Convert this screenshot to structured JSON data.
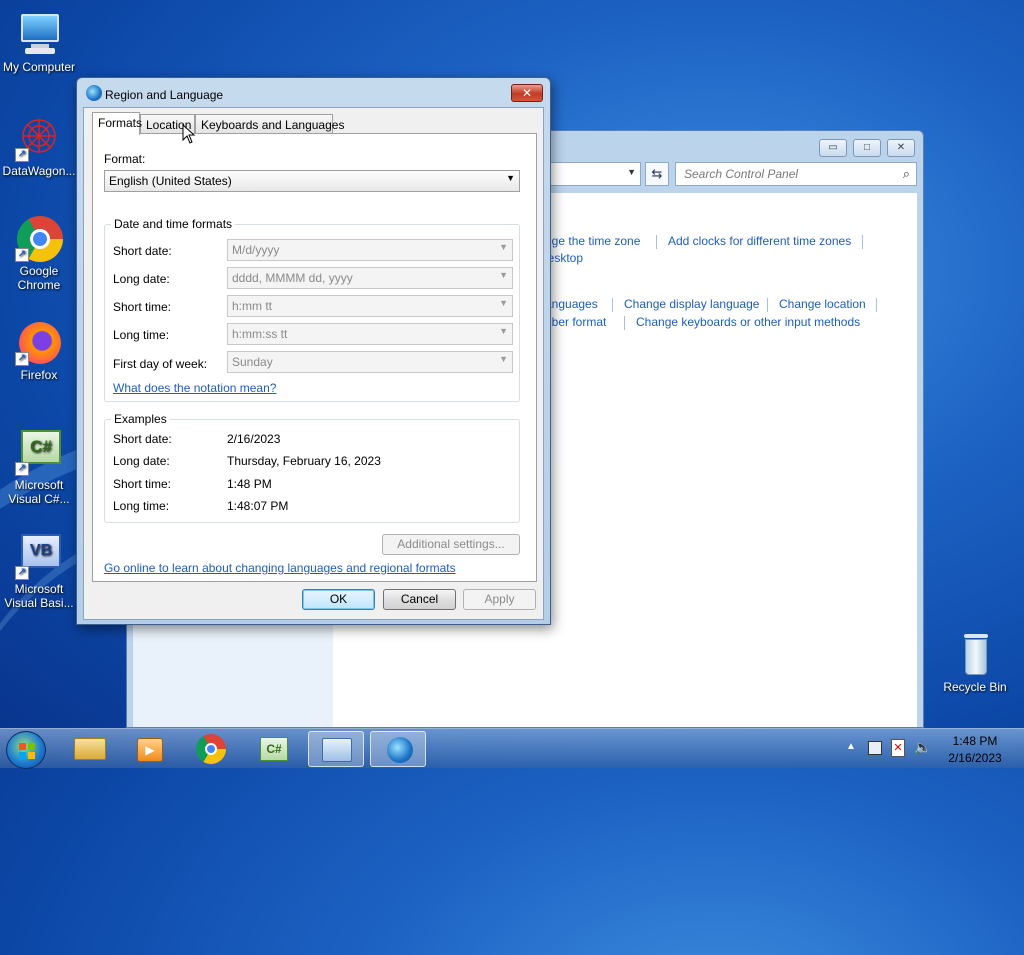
{
  "desktop": {
    "icons": [
      {
        "label": "My Computer",
        "icon": "my-computer-icon"
      },
      {
        "label": "DataWagon...",
        "icon": "datawagon-icon"
      },
      {
        "label": "Google Chrome",
        "icon": "chrome-icon"
      },
      {
        "label": "Firefox",
        "icon": "firefox-icon"
      },
      {
        "label": "Microsoft Visual C#...",
        "icon": "csharp-icon"
      },
      {
        "label": "Microsoft Visual Basi...",
        "icon": "vb-icon"
      },
      {
        "label": "Recycle Bin",
        "icon": "recycle-bin-icon"
      }
    ]
  },
  "control_panel": {
    "search_placeholder": "Search Control Panel",
    "links": [
      "nge the time zone",
      "Add clocks for different time zones",
      "lesktop",
      "anguages",
      "Change display language",
      "Change location",
      "nber format",
      "Change keyboards or other input methods"
    ]
  },
  "dialog": {
    "title": "Region and Language",
    "tabs": [
      "Formats",
      "Location",
      "Keyboards and Languages"
    ],
    "format_label": "Format:",
    "format_value": "English (United States)",
    "dt_group_title": "Date and time formats",
    "fields": [
      {
        "label": "Short date:",
        "value": "M/d/yyyy"
      },
      {
        "label": "Long date:",
        "value": "dddd, MMMM dd, yyyy"
      },
      {
        "label": "Short time:",
        "value": "h:mm tt"
      },
      {
        "label": "Long time:",
        "value": "h:mm:ss tt"
      },
      {
        "label": "First day of week:",
        "value": "Sunday"
      }
    ],
    "notation_link": "What does the notation mean?",
    "examples_title": "Examples",
    "examples": [
      {
        "label": "Short date:",
        "value": "2/16/2023"
      },
      {
        "label": "Long date:",
        "value": "Thursday, February 16, 2023"
      },
      {
        "label": "Short time:",
        "value": "1:48 PM"
      },
      {
        "label": "Long time:",
        "value": "1:48:07 PM"
      }
    ],
    "additional_settings": "Additional settings...",
    "online_link": "Go online to learn about changing languages and regional formats",
    "ok": "OK",
    "cancel": "Cancel",
    "apply": "Apply"
  },
  "taskbar": {
    "time": "1:48 PM",
    "date": "2/16/2023"
  }
}
